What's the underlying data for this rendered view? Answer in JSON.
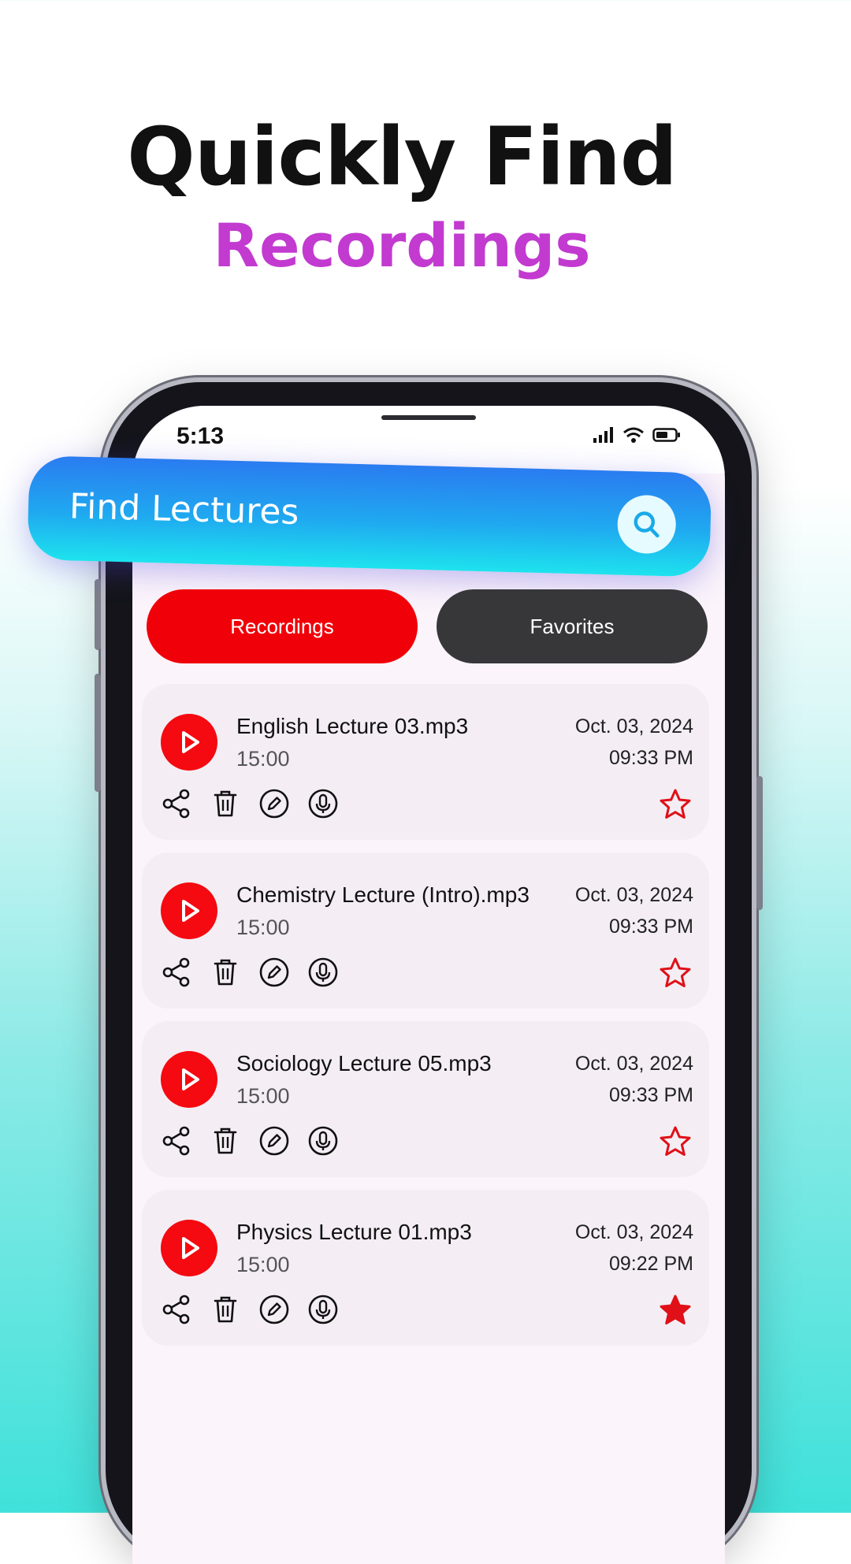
{
  "headline": {
    "line1": "Quickly Find",
    "line2": "Recordings"
  },
  "status": {
    "time": "5:13"
  },
  "search": {
    "label": "Find Lectures"
  },
  "tabs": {
    "recordings": "Recordings",
    "favorites": "Favorites"
  },
  "recordings": [
    {
      "title": "English Lecture 03.mp3",
      "duration": "15:00",
      "date": "Oct. 03, 2024",
      "time": "09:33 PM",
      "favorite": false
    },
    {
      "title": "Chemistry Lecture (Intro).mp3",
      "duration": "15:00",
      "date": "Oct. 03, 2024",
      "time": "09:33 PM",
      "favorite": false
    },
    {
      "title": "Sociology Lecture 05.mp3",
      "duration": "15:00",
      "date": "Oct. 03, 2024",
      "time": "09:33 PM",
      "favorite": false
    },
    {
      "title": "Physics Lecture 01.mp3",
      "duration": "15:00",
      "date": "Oct. 03, 2024",
      "time": "09:22 PM",
      "favorite": true
    }
  ],
  "colors": {
    "accent": "#f00008",
    "tab_inactive": "#37373a",
    "headline_accent": "#c23ad0",
    "search_bar": "#1fa9f0"
  }
}
